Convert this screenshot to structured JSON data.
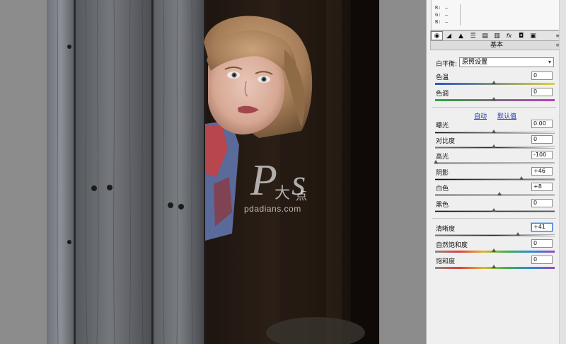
{
  "watermark": {
    "text": "pdadians.com"
  },
  "rgb_readout": [
    {
      "label": "R:",
      "value": "—"
    },
    {
      "label": "G:",
      "value": "—"
    },
    {
      "label": "B:",
      "value": "—"
    }
  ],
  "tabs": [
    {
      "icon": "aperture-icon",
      "glyph": "◉"
    },
    {
      "icon": "tone-curve-icon",
      "glyph": "◢"
    },
    {
      "icon": "detail-icon",
      "glyph": "▲"
    },
    {
      "icon": "hsl-icon",
      "glyph": "☰"
    },
    {
      "icon": "split-toning-icon",
      "glyph": "▤"
    },
    {
      "icon": "lens-icon",
      "glyph": "▥"
    },
    {
      "icon": "fx-icon",
      "glyph": "fx"
    },
    {
      "icon": "camera-calibration-icon",
      "glyph": "◘"
    },
    {
      "icon": "presets-icon",
      "glyph": "▣"
    }
  ],
  "panel": {
    "section_title": "基本",
    "white_balance": {
      "label": "白平衡:",
      "value": "原照设置"
    },
    "auto_label": "自动",
    "default_label": "默认值"
  },
  "sliders": {
    "temp": {
      "label": "色温",
      "value": "0"
    },
    "tint": {
      "label": "色调",
      "value": "0"
    },
    "exposure": {
      "label": "曝光",
      "value": "0.00"
    },
    "contrast": {
      "label": "对比度",
      "value": "0"
    },
    "highlights": {
      "label": "高光",
      "value": "-100"
    },
    "shadows": {
      "label": "阴影",
      "value": "+46"
    },
    "whites": {
      "label": "白色",
      "value": "+8"
    },
    "blacks": {
      "label": "黑色",
      "value": "0"
    },
    "clarity": {
      "label": "清晰度",
      "value": "+41"
    },
    "vibrance": {
      "label": "自然饱和度",
      "value": "0"
    },
    "saturation": {
      "label": "饱和度",
      "value": "0"
    }
  },
  "colors": {
    "panel_bg": "#efefef",
    "link": "#1a3aa8",
    "focus": "#3a7bd5"
  }
}
